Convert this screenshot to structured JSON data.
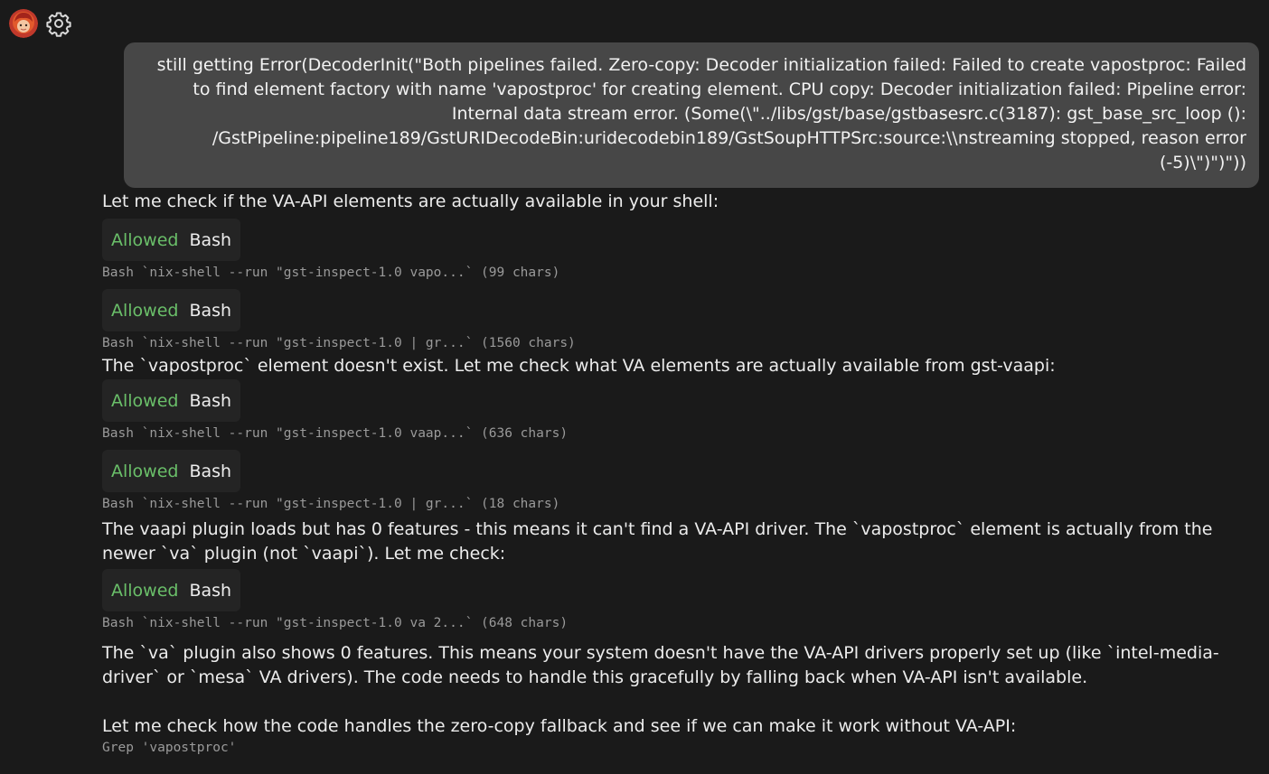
{
  "header": {
    "avatar_icon": "avatar-icon",
    "settings_icon": "gear-icon"
  },
  "user_message": "still getting Error(DecoderInit(\"Both pipelines failed. Zero-copy: Decoder initialization failed: Failed to create vapostproc: Failed to find element factory with name 'vapostproc' for creating element. CPU copy: Decoder initialization failed: Pipeline error: Internal data stream error. (Some(\\\"../libs/gst/base/gstbasesrc.c(3187): gst_base_src_loop (): /GstPipeline:pipeline189/GstURIDecodeBin:uridecodebin189/GstSoupHTTPSrc:source:\\\\nstreaming stopped, reason error (-5)\\\")\")\"))",
  "assistant": {
    "text_1": "Let me check if the VA-API elements are actually available in your shell:",
    "tool_1": {
      "status": "Allowed",
      "tool": "Bash",
      "cmd": "Bash `nix-shell --run \"gst-inspect-1.0 vapo...` (99 chars)"
    },
    "tool_2": {
      "status": "Allowed",
      "tool": "Bash",
      "cmd": "Bash `nix-shell --run \"gst-inspect-1.0 | gr...` (1560 chars)"
    },
    "text_2": "The `vapostproc` element doesn't exist. Let me check what VA elements are actually available from gst-vaapi:",
    "tool_3": {
      "status": "Allowed",
      "tool": "Bash",
      "cmd": "Bash `nix-shell --run \"gst-inspect-1.0 vaap...` (636 chars)"
    },
    "tool_4": {
      "status": "Allowed",
      "tool": "Bash",
      "cmd": "Bash `nix-shell --run \"gst-inspect-1.0 | gr...` (18 chars)"
    },
    "text_3": "The vaapi plugin loads but has 0 features - this means it can't find a VA-API driver. The `vapostproc` element is actually from the newer `va` plugin (not `vaapi`). Let me check:",
    "tool_5": {
      "status": "Allowed",
      "tool": "Bash",
      "cmd": "Bash `nix-shell --run \"gst-inspect-1.0 va 2...` (648 chars)"
    },
    "text_4": "The `va` plugin also shows 0 features. This means your system doesn't have the VA-API drivers properly set up (like `intel-media-driver` or `mesa` VA drivers). The code needs to handle this gracefully by falling back when VA-API isn't available.",
    "text_5": "Let me check how the code handles the zero-copy fallback and see if we can make it work without VA-API:",
    "tool_6": {
      "cmd": "Grep 'vapostproc'"
    }
  },
  "colors": {
    "background": "#1a1a1a",
    "user_bubble": "#474747",
    "pill_background": "#242424",
    "allowed_green": "#6abf69",
    "command_grey": "#9a9a9a"
  }
}
